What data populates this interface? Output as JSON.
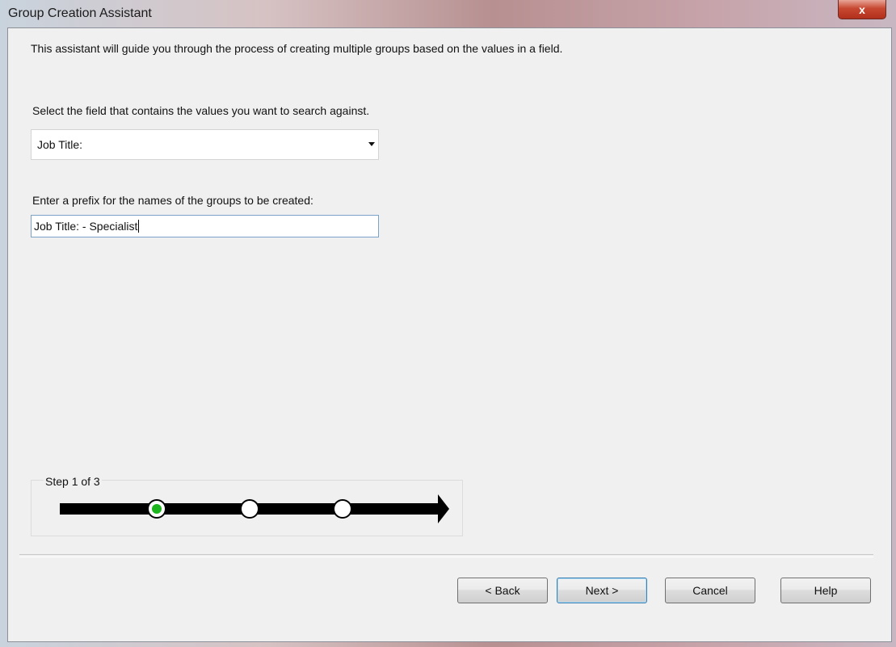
{
  "window": {
    "title": "Group Creation Assistant",
    "close_glyph": "x"
  },
  "intro_text": "This assistant will guide you through the process of creating multiple groups based on the values in a field.",
  "field_select": {
    "label": "Select the field that contains the values you want to search against.",
    "selected_value": "Job Title:"
  },
  "prefix": {
    "label": "Enter a prefix for the names of the groups to be created:",
    "value": "Job Title: - Specialist"
  },
  "progress": {
    "label": "Step 1 of 3",
    "current_step": 1,
    "total_steps": 3,
    "active_color": "#1db51d"
  },
  "buttons": {
    "back": "< Back",
    "next": "Next >",
    "cancel": "Cancel",
    "help": "Help"
  }
}
